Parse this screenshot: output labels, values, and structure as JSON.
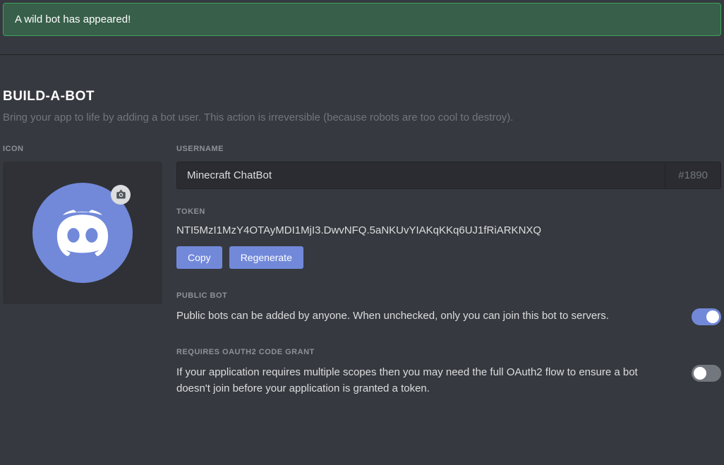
{
  "alert": {
    "message": "A wild bot has appeared!"
  },
  "section": {
    "title": "BUILD-A-BOT",
    "subtitle": "Bring your app to life by adding a bot user. This action is irreversible (because robots are too cool to destroy)."
  },
  "icon": {
    "label": "ICON"
  },
  "username": {
    "label": "USERNAME",
    "value": "Minecraft ChatBot",
    "discriminator": "#1890"
  },
  "token": {
    "label": "TOKEN",
    "value": "NTI5MzI1MzY4OTAyMDI1MjI3.DwvNFQ.5aNKUvYIAKqKKq6UJ1fRiARKNXQ",
    "copy_label": "Copy",
    "regenerate_label": "Regenerate"
  },
  "public_bot": {
    "label": "PUBLIC BOT",
    "description": "Public bots can be added by anyone. When unchecked, only you can join this bot to servers.",
    "enabled": true
  },
  "oauth_grant": {
    "label": "REQUIRES OAUTH2 CODE GRANT",
    "description": "If your application requires multiple scopes then you may need the full OAuth2 flow to ensure a bot doesn't join before your application is granted a token.",
    "enabled": false
  }
}
